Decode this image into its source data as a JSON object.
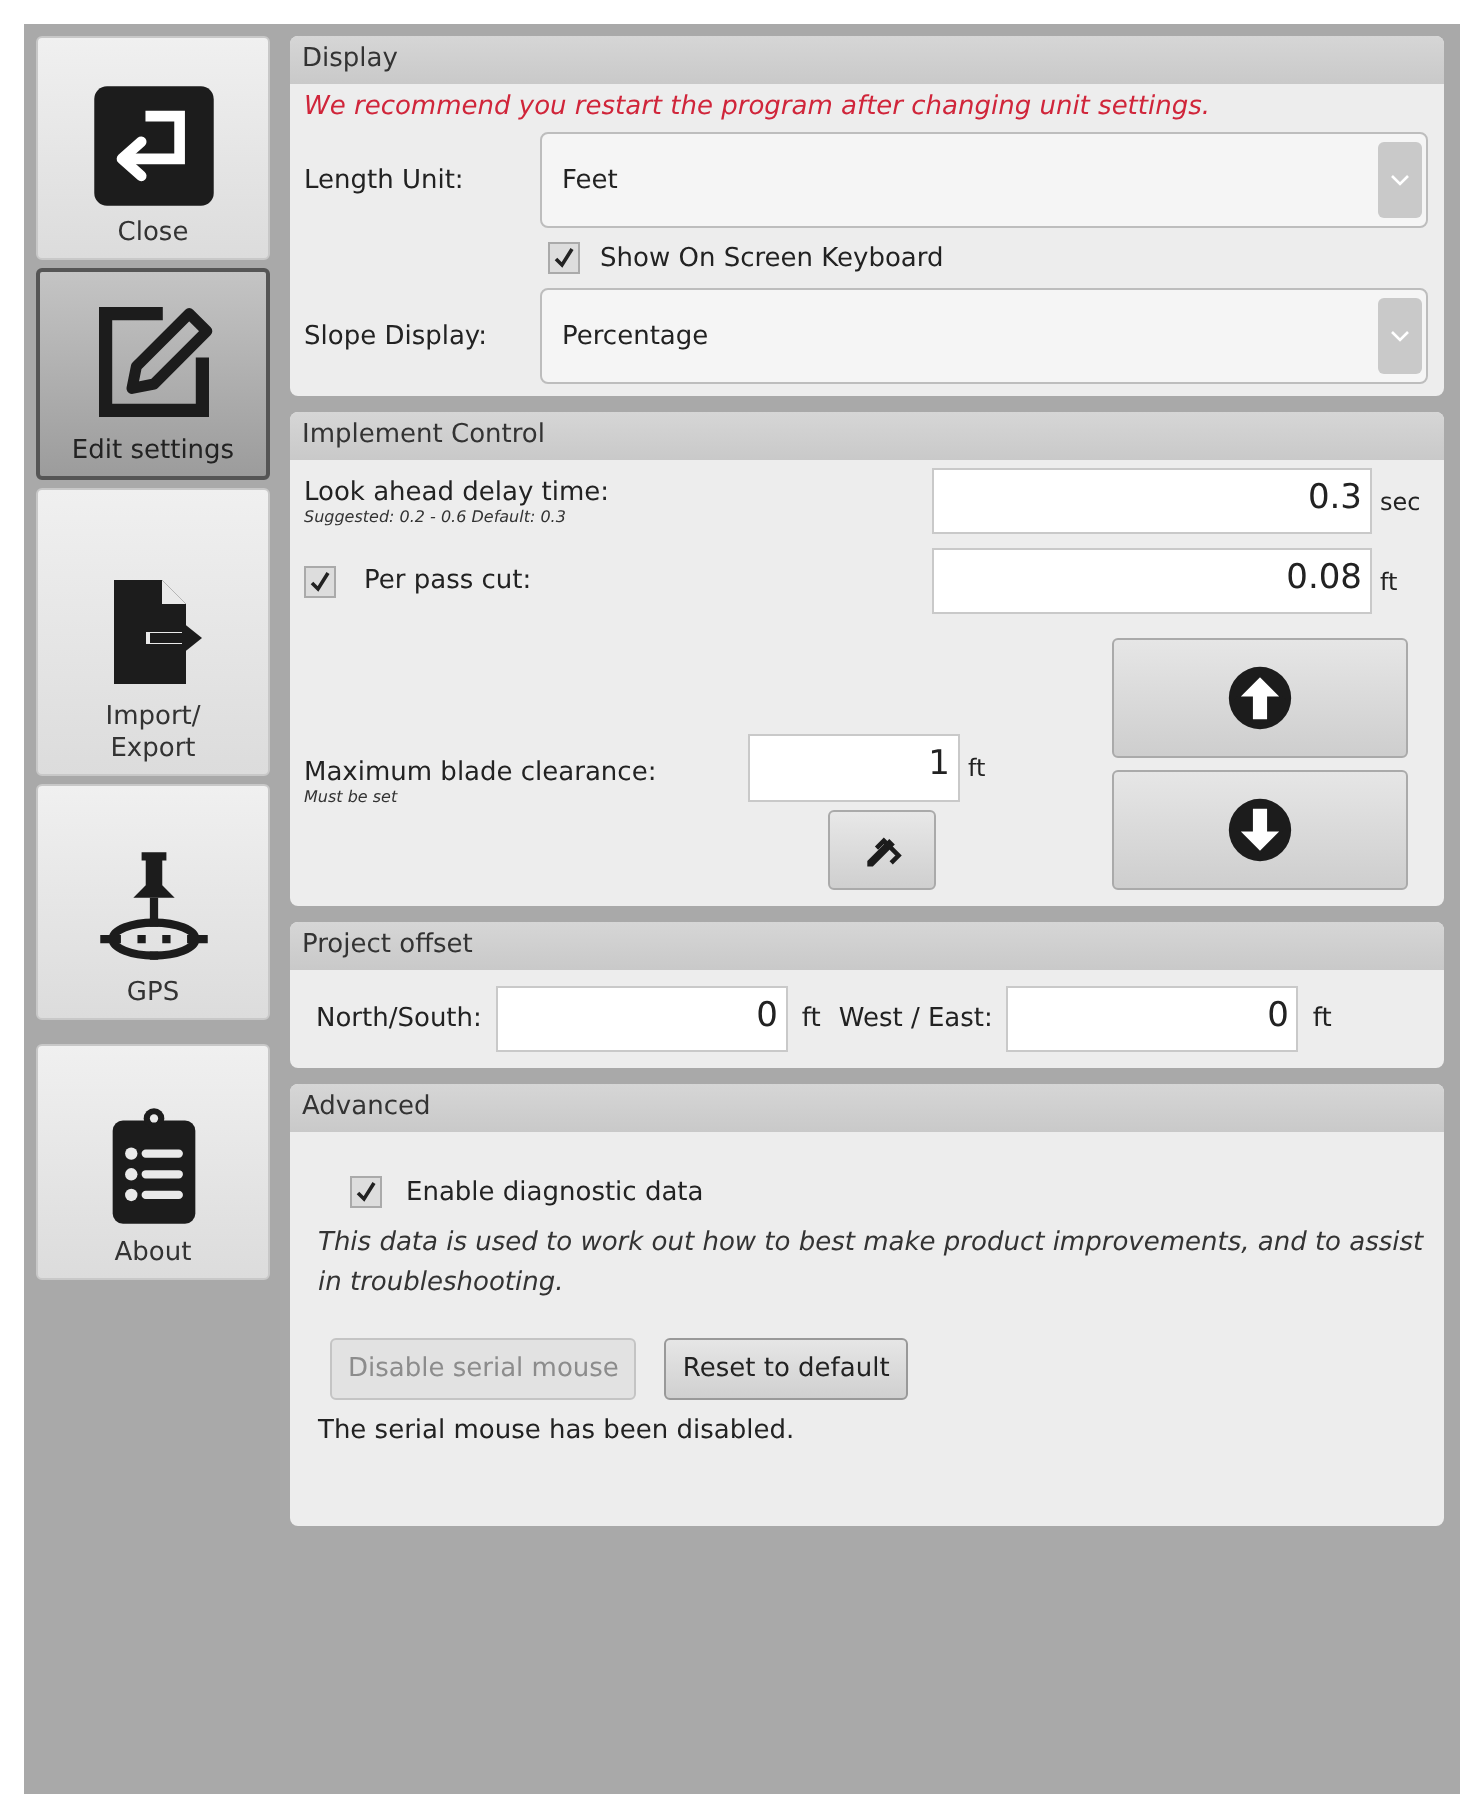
{
  "sidebar": {
    "items": [
      {
        "label": "Close",
        "kind": "close",
        "selected": false
      },
      {
        "label": "Edit settings",
        "kind": "edit",
        "selected": true
      },
      {
        "label": "Import/\nExport",
        "kind": "export",
        "selected": false
      },
      {
        "label": "GPS",
        "kind": "gps",
        "selected": false
      },
      {
        "label": "About",
        "kind": "about",
        "selected": false
      }
    ]
  },
  "display": {
    "title": "Display",
    "warning": "We recommend you restart the program after changing unit settings.",
    "length_unit": {
      "label": "Length Unit:",
      "value": "Feet"
    },
    "keyboard": {
      "label": "Show On Screen Keyboard",
      "checked": true
    },
    "slope": {
      "label": "Slope Display:",
      "value": "Percentage"
    }
  },
  "implement": {
    "title": "Implement Control",
    "look_ahead": {
      "label": "Look ahead delay time:",
      "hint": "Suggested: 0.2 - 0.6 Default: 0.3",
      "value": "0.3",
      "unit": "sec"
    },
    "per_pass": {
      "label": "Per pass cut:",
      "checked": true,
      "value": "0.08",
      "unit": "ft"
    },
    "blade": {
      "label": "Maximum blade clearance:",
      "hint": "Must be set",
      "value": "1",
      "unit": "ft"
    }
  },
  "offset": {
    "title": "Project offset",
    "north_south": {
      "label": "North/South:",
      "value": "0",
      "unit": "ft"
    },
    "west_east": {
      "label": "West / East:",
      "value": "0",
      "unit": "ft"
    }
  },
  "advanced": {
    "title": "Advanced",
    "diagnostic": {
      "label": "Enable diagnostic data",
      "checked": true
    },
    "note": "This data is used to work out how to best make product improvements, and to assist in troubleshooting.",
    "buttons": [
      {
        "label": "Disable serial mouse",
        "disabled": true
      },
      {
        "label": "Reset to default",
        "disabled": false
      }
    ],
    "status": "The serial mouse has been disabled."
  }
}
